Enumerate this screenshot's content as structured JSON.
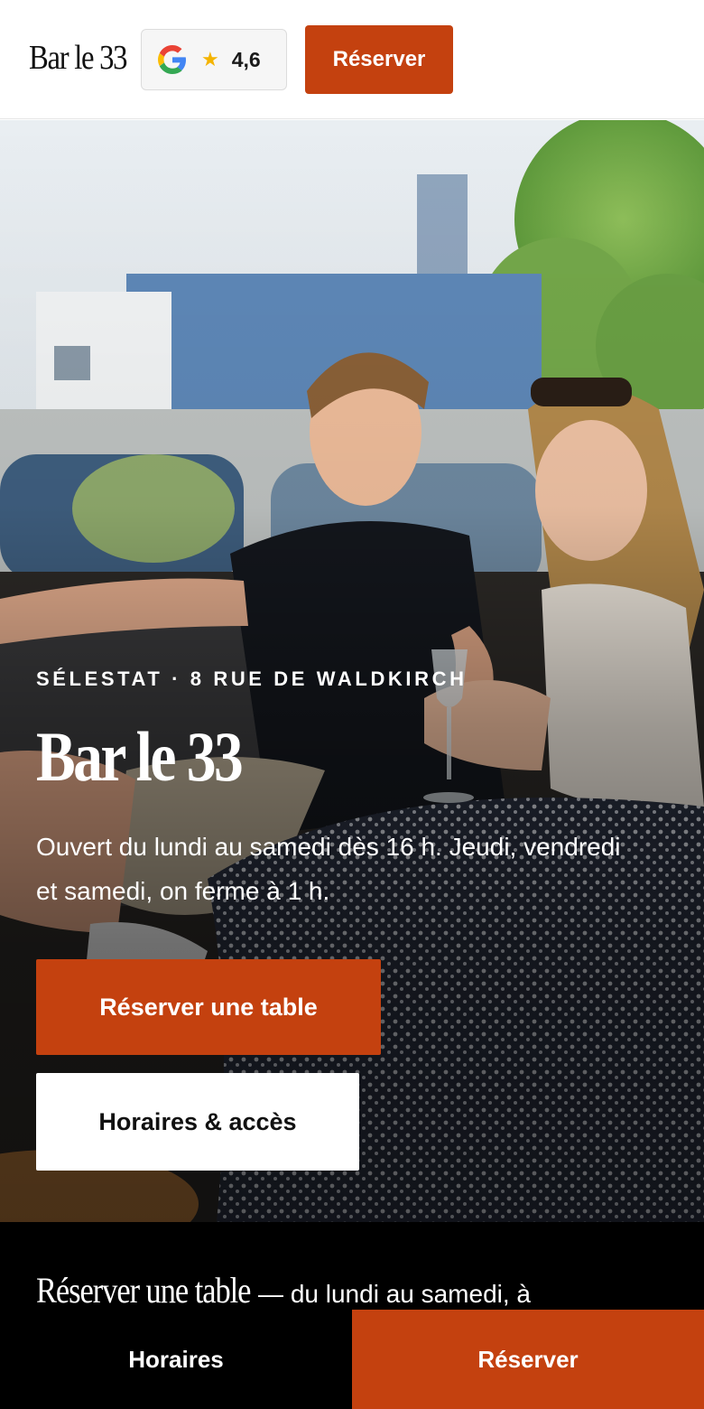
{
  "header": {
    "logo": "Bar le 33",
    "rating_icon": "google-g-icon",
    "rating_star": "★",
    "rating_score": "4,6",
    "reserve_label": "Réserver"
  },
  "hero": {
    "image": "photo of two smiling people sitting on a terrace bench",
    "eyebrow": "SÉLESTAT · 8 RUE DE WALDKIRCH",
    "title": "Bar le 33",
    "text": "Ouvert du lundi au samedi dès 16 h. Jeudi, vendredi et samedi, on ferme à 1 h.",
    "primary_button": "Réserver une table",
    "secondary_button": "Horaires & accès"
  },
  "band": {
    "serif_text": "Réserver une table",
    "sans_text": "— du lundi au samedi, à"
  },
  "bottom_bar": {
    "left_label": "Horaires",
    "right_label": "Réserver"
  },
  "colors": {
    "accent": "#c4410f",
    "dark": "#000000",
    "light": "#ffffff"
  }
}
